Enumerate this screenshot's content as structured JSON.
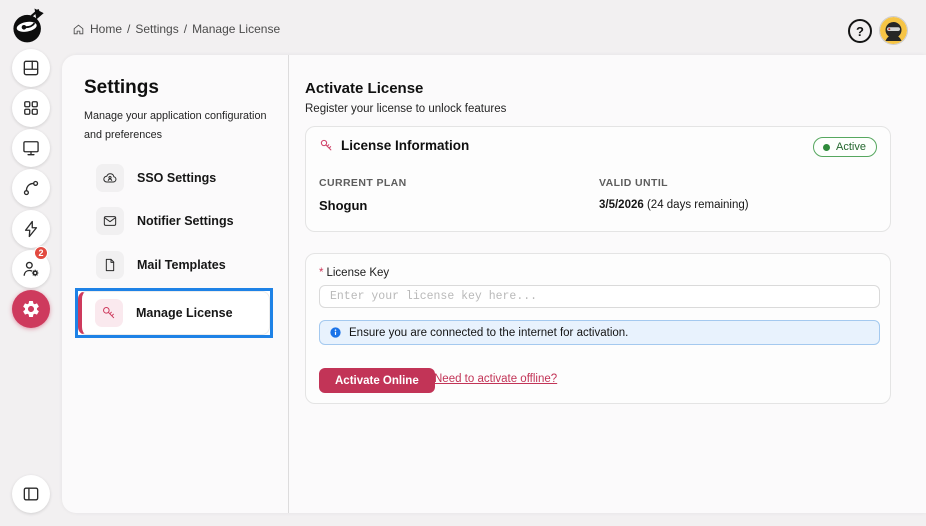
{
  "colors": {
    "accent": "#c23457",
    "active_pink": "#ce3a5d",
    "focus_blue": "#1e82e6",
    "success_green": "#2e8b3a",
    "info_blue": "#1a73e8",
    "notification_red": "#e24a40",
    "avatar_yellow": "#f6c445"
  },
  "topbar": {
    "breadcrumb": {
      "separator": "/",
      "items": [
        "Home",
        "Settings",
        "Manage License"
      ]
    },
    "help_glyph": "?"
  },
  "rail": {
    "badge_count": "2"
  },
  "settings_nav": {
    "title": "Settings",
    "description": "Manage your application configuration and preferences",
    "items": [
      {
        "label": "SSO Settings"
      },
      {
        "label": "Notifier Settings"
      },
      {
        "label": "Mail Templates"
      },
      {
        "label": "Manage License"
      }
    ]
  },
  "main": {
    "title": "Activate License",
    "subtitle": "Register your license to unlock features",
    "license_info": {
      "title": "License Information",
      "status_label": "Active",
      "current_plan_label": "CURRENT PLAN",
      "current_plan_value": "Shogun",
      "valid_until_label": "VALID UNTIL",
      "valid_until_date": "3/5/2026",
      "valid_until_note": "(24 days remaining)"
    },
    "activation": {
      "required_mark": "*",
      "license_key_label": "License Key",
      "license_key_placeholder": "Enter your license key here...",
      "info_message": "Ensure you are connected to the internet for activation.",
      "activate_button_label": "Activate Online",
      "offline_link_label": "Need to activate offline?"
    }
  }
}
